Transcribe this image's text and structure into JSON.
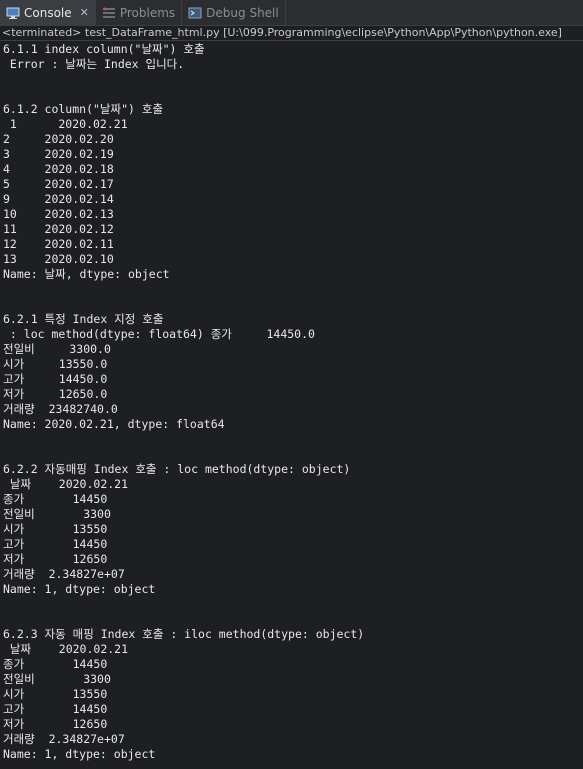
{
  "tabs": [
    {
      "label": "Console",
      "close": "✕"
    },
    {
      "label": "Problems"
    },
    {
      "label": "Debug Shell"
    }
  ],
  "status": "<terminated> test_DataFrame_html.py [U:\\099.Programming\\eclipse\\Python\\App\\Python\\python.exe]",
  "console_lines": [
    "6.1.1 index column(\"날짜\") 호출",
    " Error : 날짜는 Index 입니다.",
    "",
    "",
    "6.1.2 column(\"날짜\") 호출",
    " 1      2020.02.21",
    "2     2020.02.20",
    "3     2020.02.19",
    "4     2020.02.18",
    "5     2020.02.17",
    "9     2020.02.14",
    "10    2020.02.13",
    "11    2020.02.12",
    "12    2020.02.11",
    "13    2020.02.10",
    "Name: 날짜, dtype: object",
    "",
    "",
    "6.2.1 특정 Index 지정 호출",
    " : loc method(dtype: float64) 종가     14450.0",
    "전일비     3300.0",
    "시가     13550.0",
    "고가     14450.0",
    "저가     12650.0",
    "거래량  23482740.0",
    "Name: 2020.02.21, dtype: float64",
    "",
    "",
    "6.2.2 자동매핑 Index 호출 : loc method(dtype: object)",
    " 날짜    2020.02.21",
    "종가       14450",
    "전일비       3300",
    "시가       13550",
    "고가       14450",
    "저가       12650",
    "거래량  2.34827e+07",
    "Name: 1, dtype: object",
    "",
    "",
    "6.2.3 자동 매핑 Index 호출 : iloc method(dtype: object)",
    " 날짜    2020.02.21",
    "종가       14450",
    "전일비       3300",
    "시가       13550",
    "고가       14450",
    "저가       12650",
    "거래량  2.34827e+07",
    "Name: 1, dtype: object"
  ]
}
